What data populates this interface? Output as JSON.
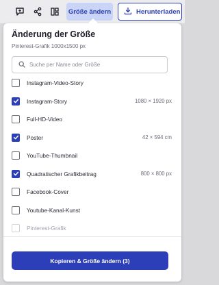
{
  "toolbar": {
    "icons": [
      "comment-plus-icon",
      "share-icon",
      "layout-grid-icon",
      "download-icon"
    ],
    "resize_label": "Größe ändern",
    "download_label": "Herunterladen"
  },
  "panel": {
    "title": "Änderung der Größe",
    "subtitle": "Pinterest-Grafik 1000x1500 px",
    "search_placeholder": "Suche per Name oder Größe",
    "search_value": "",
    "items": [
      {
        "label": "Instagram-Video-Story",
        "checked": false,
        "disabled": false,
        "size": ""
      },
      {
        "label": "Instagram-Story",
        "checked": true,
        "disabled": false,
        "size": "1080 × 1920 px"
      },
      {
        "label": "Full-HD-Video",
        "checked": false,
        "disabled": false,
        "size": ""
      },
      {
        "label": "Poster",
        "checked": true,
        "disabled": false,
        "size": "42 × 594 cm"
      },
      {
        "label": "YouTube-Thumbnail",
        "checked": false,
        "disabled": false,
        "size": ""
      },
      {
        "label": "Quadratischer Grafikbeitrag",
        "checked": true,
        "disabled": false,
        "size": "800 × 800 px"
      },
      {
        "label": "Facebook-Cover",
        "checked": false,
        "disabled": false,
        "size": ""
      },
      {
        "label": "Youtube-Kanal-Kunst",
        "checked": false,
        "disabled": false,
        "size": ""
      },
      {
        "label": "Pinterest-Grafik",
        "checked": false,
        "disabled": true,
        "size": ""
      }
    ],
    "copy_button_label": "Kopieren & Größe ändern (3)"
  },
  "colors": {
    "accent": "#2c3fb8",
    "accent_light": "#c9d4f7",
    "panel_bg": "#ffffff",
    "backdrop": "#d9d9dc"
  }
}
